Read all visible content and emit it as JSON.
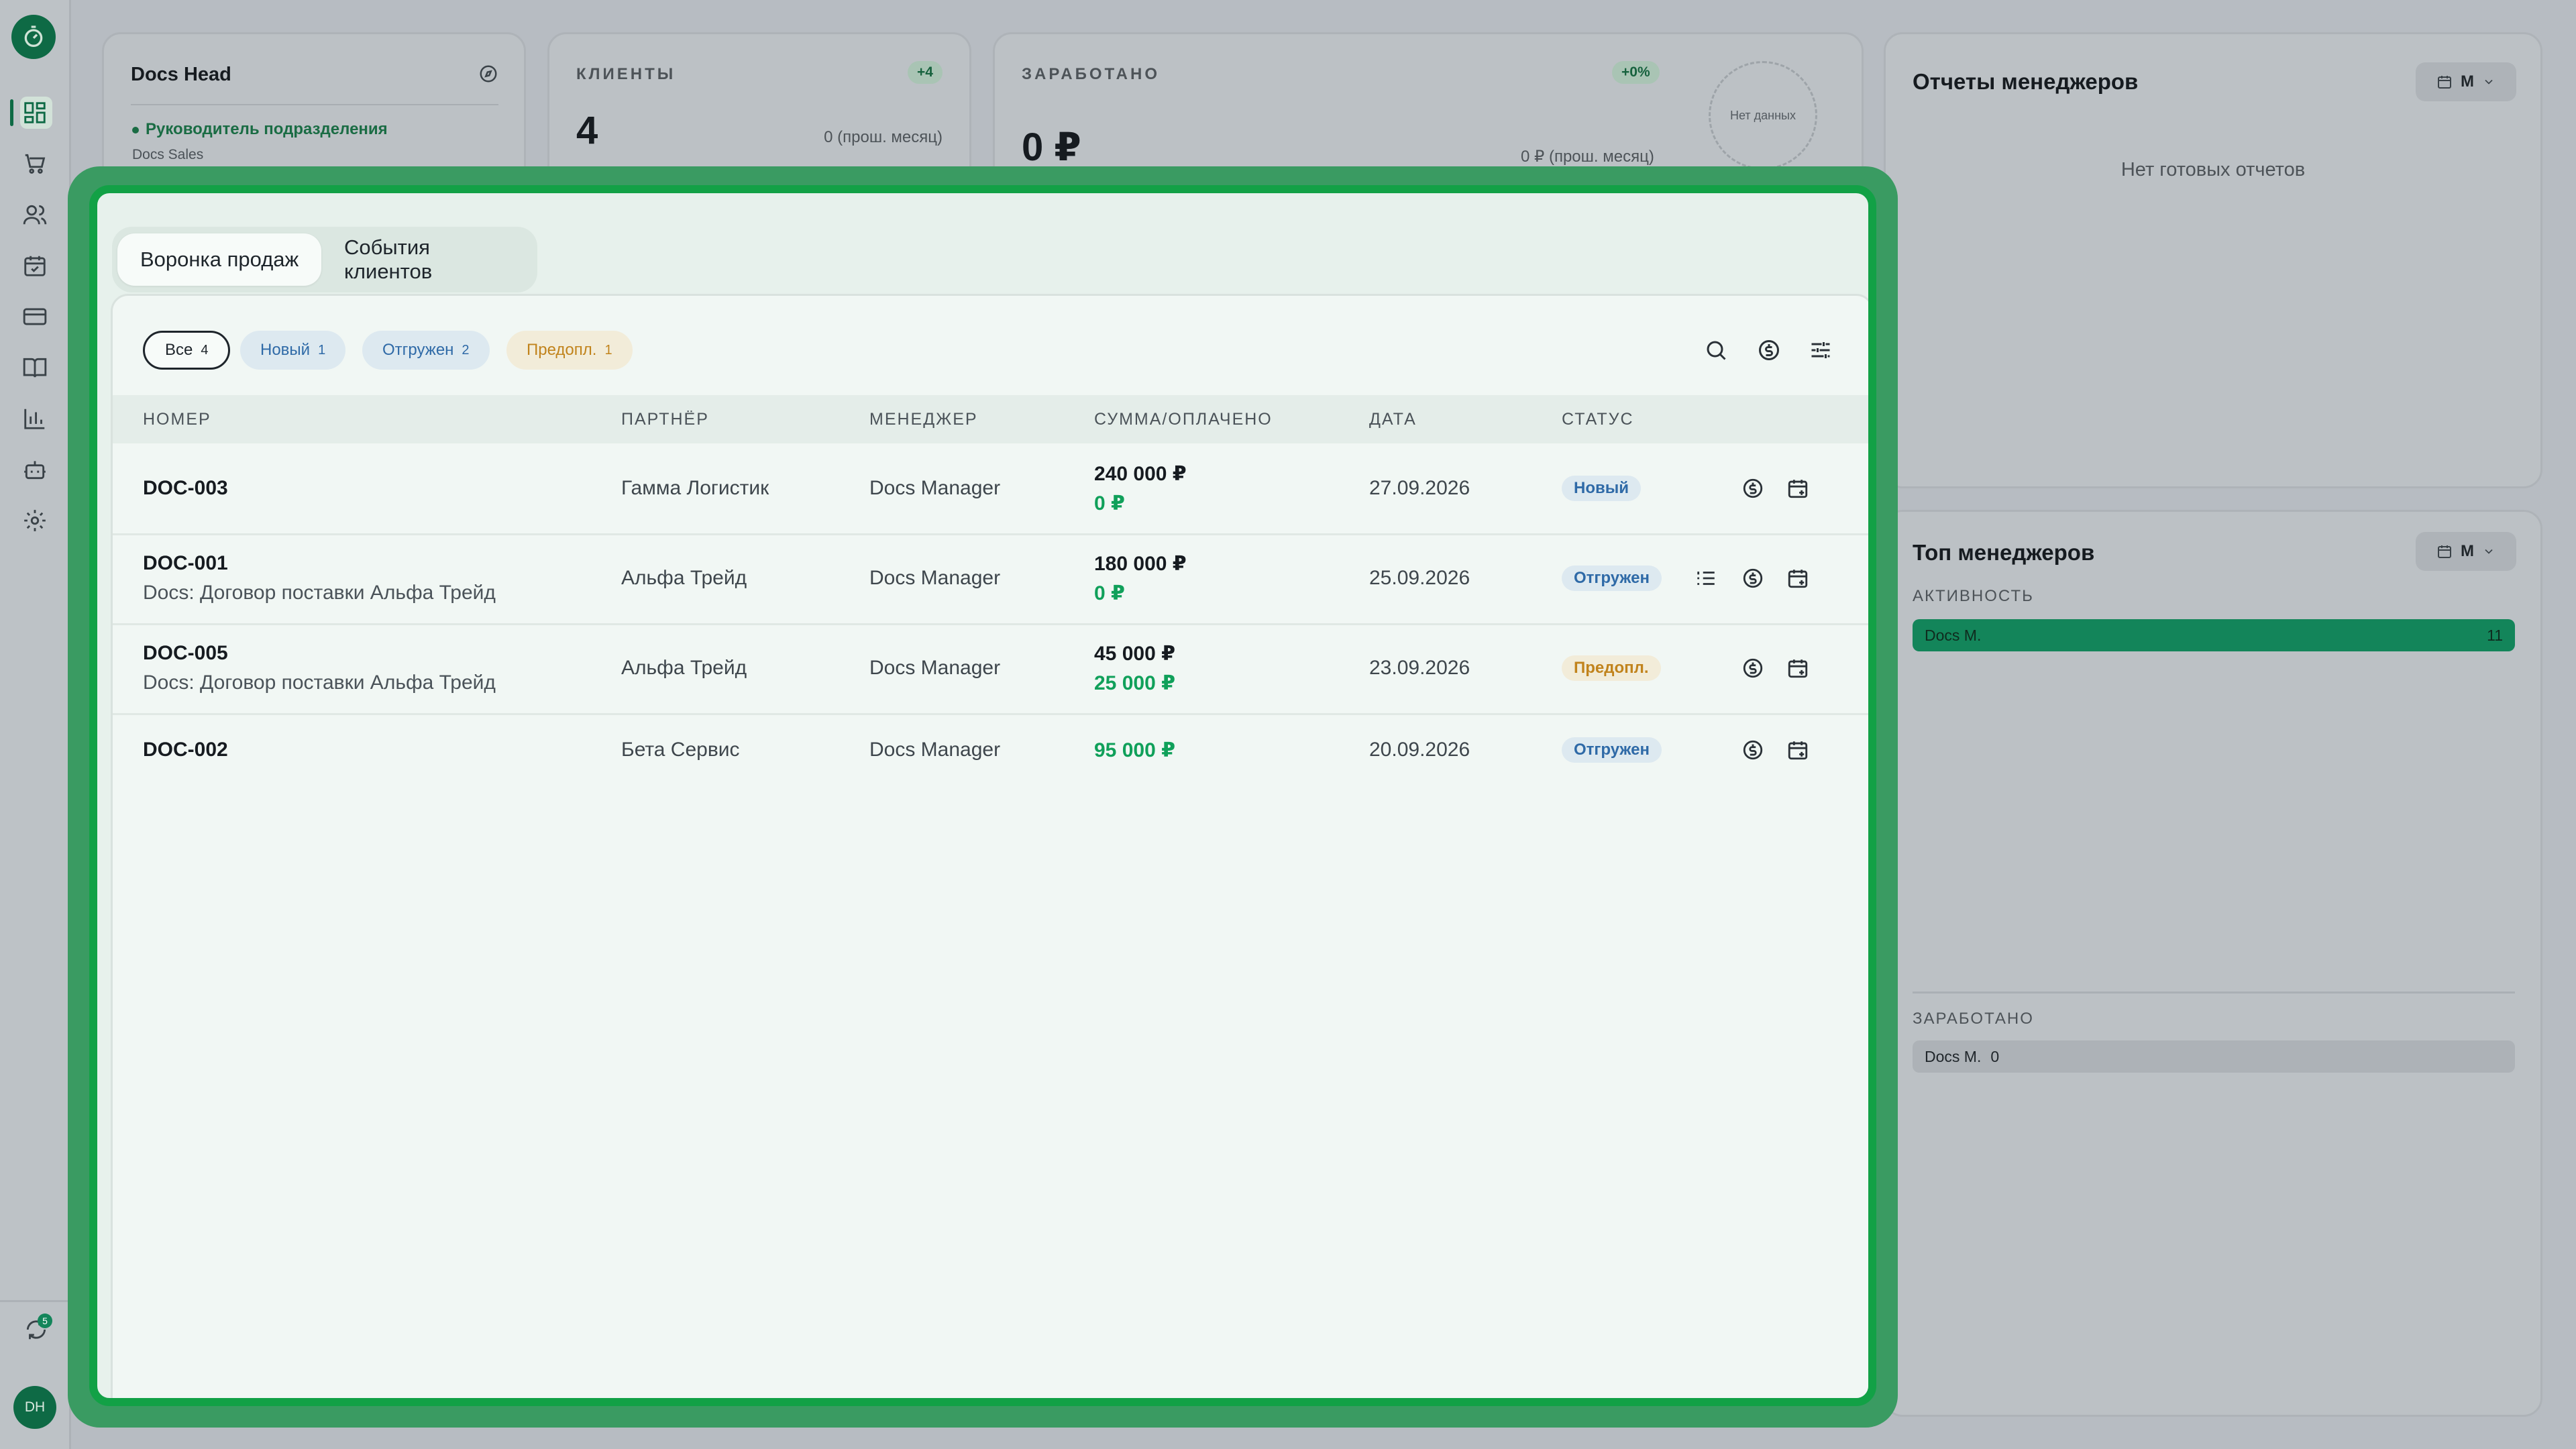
{
  "sidebar": {
    "items": [
      "dashboard-icon",
      "cart-icon",
      "users-icon",
      "calendar-icon",
      "card-icon",
      "book-icon",
      "chart-icon",
      "bot-icon",
      "gear-icon"
    ],
    "sync_badge": "5",
    "avatar": "DH"
  },
  "head_card": {
    "title": "Docs Head",
    "role": "Руководитель подразделения",
    "department": "Docs Sales"
  },
  "clients_card": {
    "label": "КЛИЕНТЫ",
    "badge": "+4",
    "value": "4",
    "previous": "0 (прош. месяц)"
  },
  "earned_card": {
    "label": "ЗАРАБОТАНО",
    "badge": "+0%",
    "value": "0 ₽",
    "previous": "0 ₽ (прош. месяц)",
    "chart_empty": "Нет данных"
  },
  "reports_card": {
    "title": "Отчеты менеджеров",
    "period": "М",
    "empty": "Нет готовых отчетов"
  },
  "top_card": {
    "title": "Топ менеджеров",
    "period": "М",
    "activity_label": "АКТИВНОСТЬ",
    "activity": {
      "name": "Docs M.",
      "value": "11"
    },
    "earned_label": "ЗАРАБОТАНО",
    "earned": {
      "name": "Docs M.",
      "value": "0"
    }
  },
  "panel": {
    "tabs": [
      "Воронка продаж",
      "События клиентов"
    ],
    "filters": [
      {
        "label": "Все",
        "count": "4"
      },
      {
        "label": "Новый",
        "count": "1"
      },
      {
        "label": "Отгружен",
        "count": "2"
      },
      {
        "label": "Предопл.",
        "count": "1"
      }
    ],
    "columns": [
      "НОМЕР",
      "ПАРТНЁР",
      "МЕНЕДЖЕР",
      "СУММА/ОПЛАЧЕНО",
      "ДАТА",
      "СТАТУС"
    ],
    "rows": [
      {
        "number": "DOC-003",
        "description": "",
        "partner": "Гамма Логистик",
        "manager": "Docs Manager",
        "sum": "240 000 ₽",
        "paid": "0 ₽",
        "date": "27.09.2026",
        "status": "Новый"
      },
      {
        "number": "DOC-001",
        "description": "Docs: Договор поставки Альфа Трейд",
        "partner": "Альфа Трейд",
        "manager": "Docs Manager",
        "sum": "180 000 ₽",
        "paid": "0 ₽",
        "date": "25.09.2026",
        "status": "Отгружен"
      },
      {
        "number": "DOC-005",
        "description": "Docs: Договор поставки Альфа Трейд",
        "partner": "Альфа Трейд",
        "manager": "Docs Manager",
        "sum": "45 000 ₽",
        "paid": "25 000 ₽",
        "date": "23.09.2026",
        "status": "Предопл."
      },
      {
        "number": "DOC-002",
        "description": "",
        "partner": "Бета Сервис",
        "manager": "Docs Manager",
        "sum": "",
        "paid": "95 000 ₽",
        "date": "20.09.2026",
        "status": "Отгружен"
      }
    ]
  },
  "colors": {
    "accent": "#12a146",
    "brand_dark": "#0e6a45",
    "paid_green": "#10a05a",
    "status_blue": "#2f6aa7",
    "status_orange": "#c1831c"
  }
}
